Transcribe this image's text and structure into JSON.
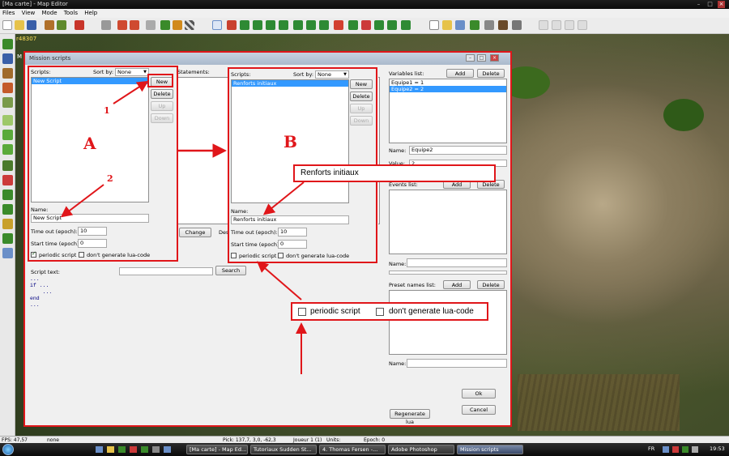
{
  "window": {
    "title": "[Ma carte] - Map Editor"
  },
  "menu": [
    "Files",
    "View",
    "Mode",
    "Tools",
    "Help"
  ],
  "viewport": {
    "coord_label": "r48307",
    "marker": "M"
  },
  "dialog": {
    "title": "Mission scripts",
    "left": {
      "scripts_label": "Scripts:",
      "sort_label": "Sort by:",
      "sort_value": "None",
      "items": [
        "New Script"
      ],
      "new_btn": "New",
      "delete_btn": "Delete",
      "up_btn": "Up",
      "down_btn": "Down",
      "name_label": "Name:",
      "name_value": "New Script",
      "timeout_label": "Time out (epoch):",
      "timeout_value": "10",
      "start_label": "Start time (epoch):",
      "start_value": "0",
      "periodic_label": "periodic script",
      "periodic_checked": true,
      "nolua_label": "don't generate lua-code",
      "nolua_checked": false,
      "script_text_label": "Script text:",
      "search_btn": "Search",
      "code_lines": [
        "...",
        "if ...",
        "    ...",
        "end",
        "..."
      ]
    },
    "middle": {
      "statements_label": "Statements:",
      "change_btn": "Change",
      "des_label": "Des"
    },
    "overlay": {
      "scripts_label": "Scripts:",
      "sort_label": "Sort by:",
      "sort_value": "None",
      "items": [
        "Renforts initiaux"
      ],
      "new_btn": "New",
      "delete_btn": "Delete",
      "up_btn": "Up",
      "down_btn": "Down",
      "name_label": "Name:",
      "name_value": "Renforts initiaux",
      "timeout_label": "Time out (epoch):",
      "timeout_value": "10",
      "start_label": "Start time (epoch):",
      "start_value": "0",
      "periodic_label": "periodic script",
      "periodic_checked": false,
      "nolua_label": "don't generate lua-code",
      "nolua_checked": false
    },
    "right": {
      "variables_label": "Variables list:",
      "add_btn": "Add",
      "delete_btn": "Delete",
      "variables": [
        "Equipe1 = 1",
        "Equipe2 = 2"
      ],
      "name_label": "Name:",
      "name_value": "Equipe2",
      "value_label": "Value:",
      "value_value": "2",
      "events_label": "Events list:",
      "events_add": "Add",
      "events_delete": "Delete",
      "name2_label": "Name:",
      "presets_label": "Preset names list:",
      "presets_add": "Add",
      "presets_delete": "Delete",
      "name3_label": "Name:",
      "ok_btn": "Ok",
      "cancel_btn": "Cancel",
      "regen_btn": "Regenerate lua"
    }
  },
  "annotations": {
    "label_a": "A",
    "label_b": "B",
    "num_1": "1",
    "num_2": "2",
    "callout_name": "Renforts initiaux",
    "callout_periodic": "periodic script",
    "callout_nolua": "don't generate lua-code",
    "color": "#e0161a"
  },
  "statusbar": {
    "fps": "FPS: 47,57",
    "mode": "none",
    "pick": "Pick: 137,7, 3,0, -62,3",
    "joueur": "Joueur 1 (1)",
    "units": "Units:",
    "epoch": "Epoch: 0"
  },
  "taskbar": {
    "tasks": [
      "[Ma carte] - Map Ed...",
      "Tutoriaux Sudden St...",
      "4. Thomas Fersen -...",
      "Adobe Photoshop",
      "Mission scripts"
    ],
    "lang": "FR",
    "clock": "19:53"
  }
}
